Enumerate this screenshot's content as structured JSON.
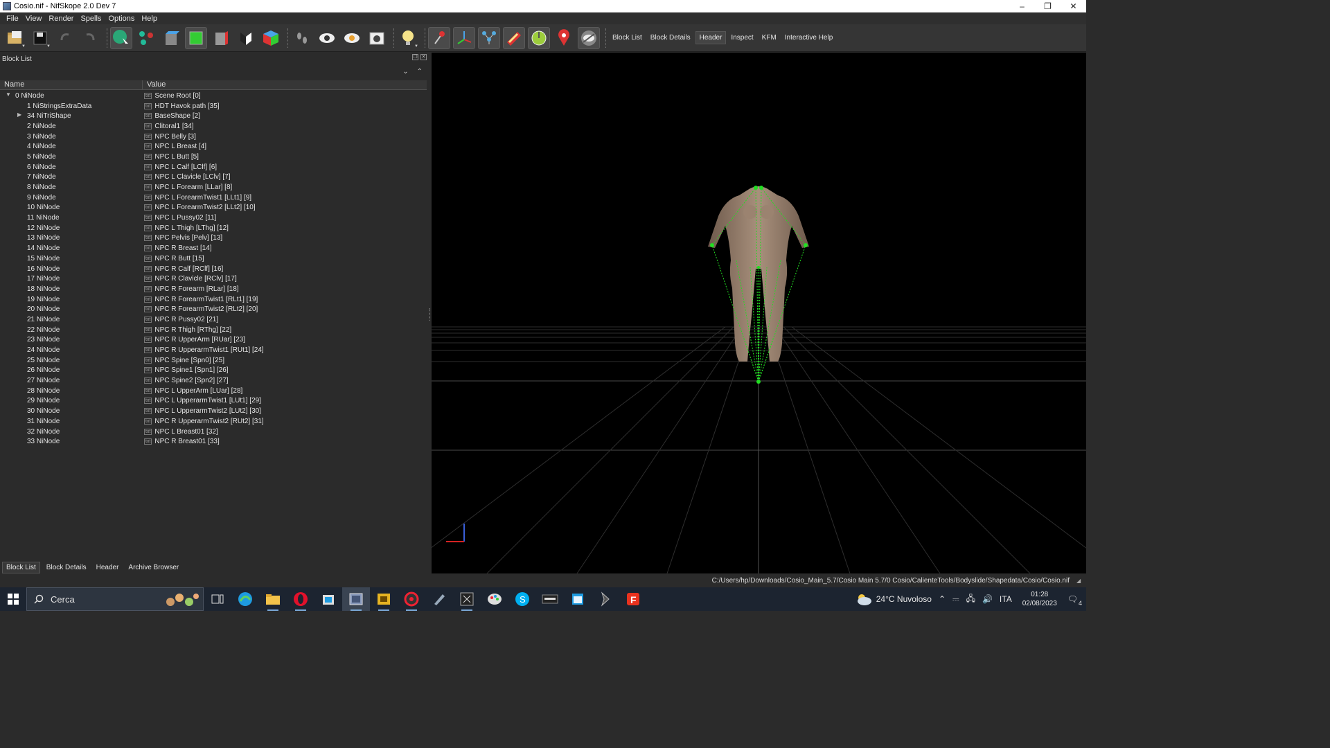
{
  "window": {
    "title": "Cosio.nif - NifSkope 2.0 Dev 7",
    "controls": [
      "minimize",
      "restore",
      "close"
    ]
  },
  "menu": [
    "File",
    "View",
    "Render",
    "Spells",
    "Options",
    "Help"
  ],
  "toolbar": {
    "text_buttons": [
      {
        "label": "Block List",
        "active": false
      },
      {
        "label": "Block Details",
        "active": false
      },
      {
        "label": "Header",
        "active": true
      },
      {
        "label": "Inspect",
        "active": false
      },
      {
        "label": "KFM",
        "active": false
      },
      {
        "label": "Interactive Help",
        "active": false
      }
    ]
  },
  "block_list": {
    "title": "Block List",
    "columns": [
      "Name",
      "Value"
    ],
    "rows": [
      {
        "name": "0 NiNode",
        "value": "Scene Root [0]",
        "level": 0,
        "arrow": "expanded"
      },
      {
        "name": "1 NiStringsExtraData",
        "value": "HDT Havok path [35]",
        "level": 1,
        "arrow": ""
      },
      {
        "name": "34 NiTriShape",
        "value": "BaseShape [2]",
        "level": 1,
        "arrow": "collapsed"
      },
      {
        "name": "2 NiNode",
        "value": "Clitoral1 [34]",
        "level": 1,
        "arrow": ""
      },
      {
        "name": "3 NiNode",
        "value": "NPC Belly [3]",
        "level": 1,
        "arrow": ""
      },
      {
        "name": "4 NiNode",
        "value": "NPC L Breast [4]",
        "level": 1,
        "arrow": ""
      },
      {
        "name": "5 NiNode",
        "value": "NPC L Butt [5]",
        "level": 1,
        "arrow": ""
      },
      {
        "name": "6 NiNode",
        "value": "NPC L Calf [LClf] [6]",
        "level": 1,
        "arrow": ""
      },
      {
        "name": "7 NiNode",
        "value": "NPC L Clavicle [LClv] [7]",
        "level": 1,
        "arrow": ""
      },
      {
        "name": "8 NiNode",
        "value": "NPC L Forearm [LLar] [8]",
        "level": 1,
        "arrow": ""
      },
      {
        "name": "9 NiNode",
        "value": "NPC L ForearmTwist1 [LLt1] [9]",
        "level": 1,
        "arrow": ""
      },
      {
        "name": "10 NiNode",
        "value": "NPC L ForearmTwist2 [LLt2] [10]",
        "level": 1,
        "arrow": ""
      },
      {
        "name": "11 NiNode",
        "value": "NPC L Pussy02 [11]",
        "level": 1,
        "arrow": ""
      },
      {
        "name": "12 NiNode",
        "value": "NPC L Thigh [LThg] [12]",
        "level": 1,
        "arrow": ""
      },
      {
        "name": "13 NiNode",
        "value": "NPC Pelvis [Pelv] [13]",
        "level": 1,
        "arrow": ""
      },
      {
        "name": "14 NiNode",
        "value": "NPC R Breast [14]",
        "level": 1,
        "arrow": ""
      },
      {
        "name": "15 NiNode",
        "value": "NPC R Butt [15]",
        "level": 1,
        "arrow": ""
      },
      {
        "name": "16 NiNode",
        "value": "NPC R Calf [RClf] [16]",
        "level": 1,
        "arrow": ""
      },
      {
        "name": "17 NiNode",
        "value": "NPC R Clavicle [RClv] [17]",
        "level": 1,
        "arrow": ""
      },
      {
        "name": "18 NiNode",
        "value": "NPC R Forearm [RLar] [18]",
        "level": 1,
        "arrow": ""
      },
      {
        "name": "19 NiNode",
        "value": "NPC R ForearmTwist1 [RLt1] [19]",
        "level": 1,
        "arrow": ""
      },
      {
        "name": "20 NiNode",
        "value": "NPC R ForearmTwist2 [RLt2] [20]",
        "level": 1,
        "arrow": ""
      },
      {
        "name": "21 NiNode",
        "value": "NPC R Pussy02 [21]",
        "level": 1,
        "arrow": ""
      },
      {
        "name": "22 NiNode",
        "value": "NPC R Thigh [RThg] [22]",
        "level": 1,
        "arrow": ""
      },
      {
        "name": "23 NiNode",
        "value": "NPC R UpperArm [RUar] [23]",
        "level": 1,
        "arrow": ""
      },
      {
        "name": "24 NiNode",
        "value": "NPC R UpperarmTwist1 [RUt1] [24]",
        "level": 1,
        "arrow": ""
      },
      {
        "name": "25 NiNode",
        "value": "NPC Spine [Spn0] [25]",
        "level": 1,
        "arrow": ""
      },
      {
        "name": "26 NiNode",
        "value": "NPC Spine1 [Spn1] [26]",
        "level": 1,
        "arrow": ""
      },
      {
        "name": "27 NiNode",
        "value": "NPC Spine2 [Spn2] [27]",
        "level": 1,
        "arrow": ""
      },
      {
        "name": "28 NiNode",
        "value": "NPC L UpperArm [LUar] [28]",
        "level": 1,
        "arrow": ""
      },
      {
        "name": "29 NiNode",
        "value": "NPC L UpperarmTwist1 [LUt1] [29]",
        "level": 1,
        "arrow": ""
      },
      {
        "name": "30 NiNode",
        "value": "NPC L UpperarmTwist2 [LUt2] [30]",
        "level": 1,
        "arrow": ""
      },
      {
        "name": "31 NiNode",
        "value": "NPC R UpperarmTwist2 [RUt2] [31]",
        "level": 1,
        "arrow": ""
      },
      {
        "name": "32 NiNode",
        "value": "NPC L Breast01 [32]",
        "level": 1,
        "arrow": ""
      },
      {
        "name": "33 NiNode",
        "value": "NPC R Breast01 [33]",
        "level": 1,
        "arrow": ""
      }
    ]
  },
  "bottom_tabs": [
    {
      "label": "Block List",
      "active": true
    },
    {
      "label": "Block Details",
      "active": false
    },
    {
      "label": "Header",
      "active": false
    },
    {
      "label": "Archive Browser",
      "active": false
    }
  ],
  "status": {
    "path": "C:/Users/hp/Downloads/Cosio_Main_5.7/Cosio Main 5.7/0 Cosio/CalienteTools/Bodyslide/Shapedata/Cosio/Cosio.nif"
  },
  "taskbar": {
    "search_placeholder": "Cerca",
    "weather": "24°C  Nuvoloso",
    "language": "ITA",
    "time": "01:28",
    "date": "02/08/2023",
    "notifications": "4"
  },
  "colors": {
    "skeleton": "#22dd22",
    "viewport_bg": "#000000",
    "grid": "#3a3a3a"
  }
}
